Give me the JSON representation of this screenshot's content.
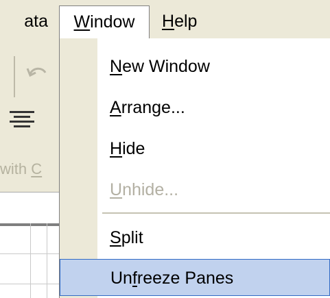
{
  "menubar": {
    "data_label": "ata",
    "window": {
      "accel": "W",
      "rest": "indow"
    },
    "help": {
      "accel": "H",
      "rest": "elp"
    }
  },
  "left": {
    "with_text": "with ",
    "with_accel": "C"
  },
  "window_menu": {
    "items": [
      {
        "pre": "",
        "accel": "N",
        "post": "ew Window",
        "enabled": true
      },
      {
        "pre": "",
        "accel": "A",
        "post": "rrange...",
        "enabled": true
      },
      {
        "pre": "",
        "accel": "H",
        "post": "ide",
        "enabled": true
      },
      {
        "pre": "",
        "accel": "U",
        "post": "nhide...",
        "enabled": false
      },
      {
        "pre": "",
        "accel": "S",
        "post": "plit",
        "enabled": true
      },
      {
        "pre": "Un",
        "accel": "f",
        "post": "reeze Panes",
        "enabled": true,
        "highlighted": true
      }
    ]
  },
  "colors": {
    "menu_bg": "#ece9d8",
    "highlight_bg": "#c1d2ee",
    "highlight_border": "#316ac5",
    "disabled_text": "#b3b0a3"
  }
}
